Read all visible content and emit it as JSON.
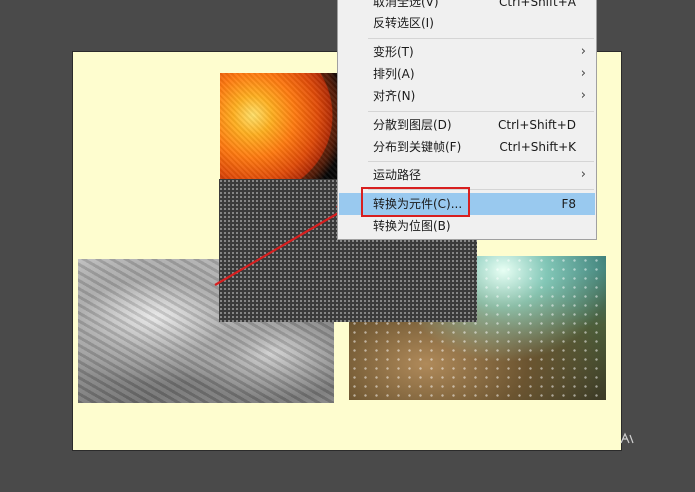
{
  "menu": {
    "items": [
      {
        "id": "deselect",
        "label": "取消全选(V)",
        "shortcut": "Ctrl+Shift+A",
        "submenu": false
      },
      {
        "id": "invert",
        "label": "反转选区(I)",
        "shortcut": "",
        "submenu": false
      },
      {
        "id": "transform",
        "label": "变形(T)",
        "shortcut": "",
        "submenu": true
      },
      {
        "id": "arrange",
        "label": "排列(A)",
        "shortcut": "",
        "submenu": true
      },
      {
        "id": "align",
        "label": "对齐(N)",
        "shortcut": "",
        "submenu": true
      },
      {
        "id": "distribute-layers",
        "label": "分散到图层(D)",
        "shortcut": "Ctrl+Shift+D",
        "submenu": false
      },
      {
        "id": "distribute-keyframes",
        "label": "分布到关键帧(F)",
        "shortcut": "Ctrl+Shift+K",
        "submenu": false
      },
      {
        "id": "motion-path",
        "label": "运动路径",
        "shortcut": "",
        "submenu": true
      },
      {
        "id": "convert-symbol",
        "label": "转换为元件(C)...",
        "shortcut": "F8",
        "submenu": false,
        "highlighted": true
      },
      {
        "id": "convert-bitmap",
        "label": "转换为位图(B)",
        "shortcut": "",
        "submenu": false
      }
    ],
    "submenu_glyph": "›"
  },
  "colors": {
    "highlight": "#99c9ef",
    "annotation_red": "#d81f1f",
    "stage_bg": "#fefdcf",
    "workspace_bg": "#4a4a4a"
  },
  "icons": {
    "annotation_arrow": "red-arrow-icon"
  }
}
